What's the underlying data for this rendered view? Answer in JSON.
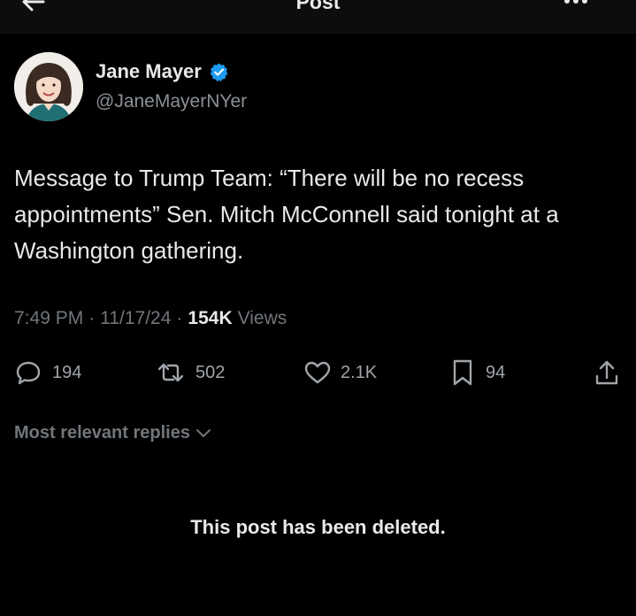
{
  "topbar": {
    "title": "Post",
    "back_icon": "arrow-left-icon",
    "more_icon": "more-dots-icon"
  },
  "author": {
    "display_name": "Jane Mayer",
    "handle": "@JaneMayerNYer",
    "verified": true,
    "verified_color": "#1d9bf0"
  },
  "post": {
    "text": "Message to Trump Team: “There will be no recess appointments” Sen. Mitch McConnell said tonight at a Washington gathering.",
    "time": "7:49 PM",
    "date": "11/17/24",
    "views_count": "154K",
    "views_label": "Views"
  },
  "actions": {
    "replies": "194",
    "reposts": "502",
    "likes": "2.1K",
    "bookmarks": "94"
  },
  "replies_filter": {
    "label": "Most relevant replies"
  },
  "reply_notice": {
    "text": "This post has been deleted."
  },
  "colors": {
    "background": "#000000",
    "text_primary": "#e7e9ea",
    "text_secondary": "#71767b",
    "accent": "#1d9bf0"
  }
}
